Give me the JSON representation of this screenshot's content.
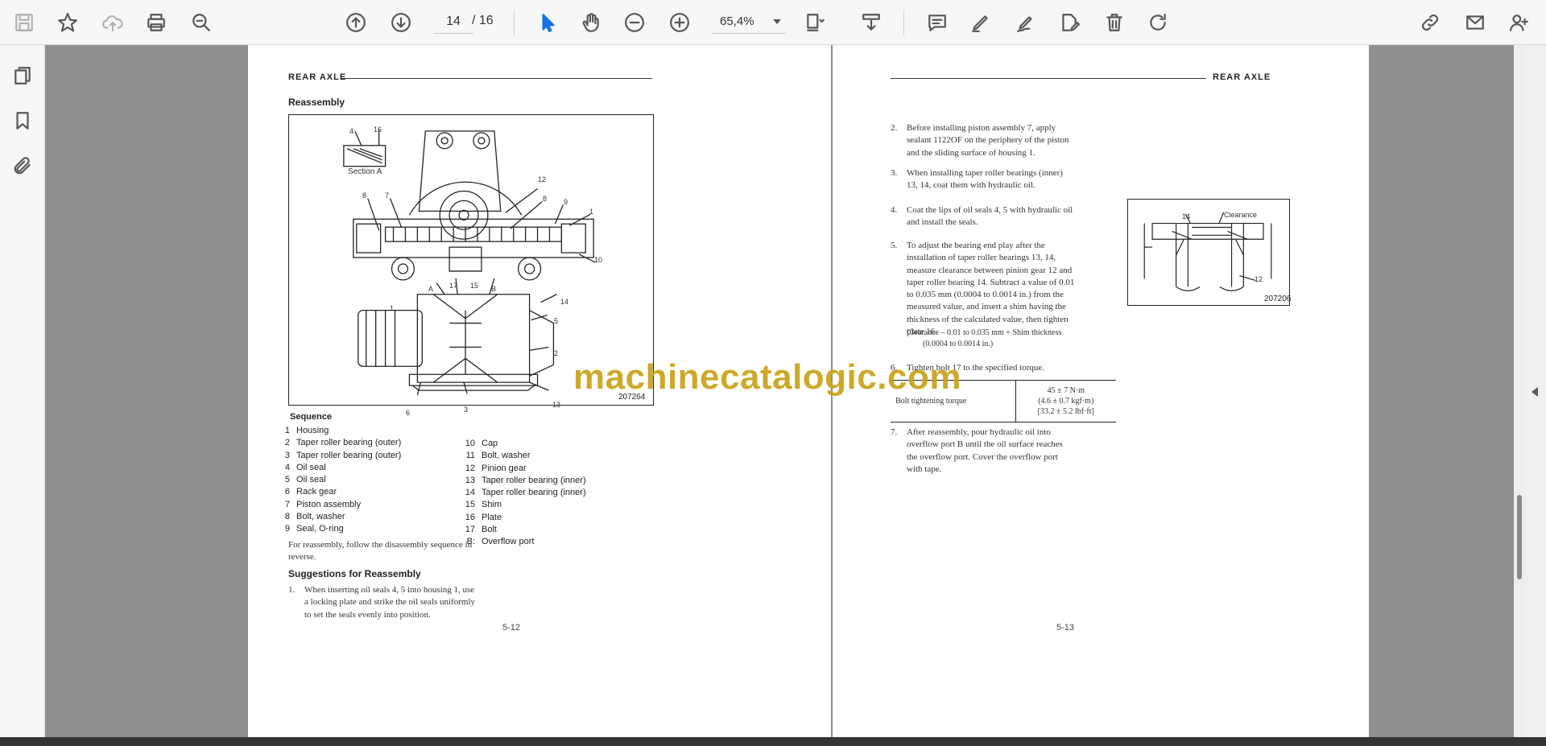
{
  "toolbar": {
    "page_current": "14",
    "page_total": "/ 16",
    "zoom": "65,4%"
  },
  "document": {
    "left_page": {
      "header": "REAR AXLE",
      "section_title": "Reassembly",
      "figure_code": "207264",
      "figure_labels": [
        "4",
        "16",
        "Section A",
        "8",
        "7",
        "12",
        "8",
        "9",
        "1",
        "10",
        "A",
        "17",
        "15",
        "B",
        "14",
        "5",
        "2",
        "13",
        "6",
        "3",
        "1"
      ],
      "sequence_title": "Sequence",
      "sequence_left": [
        {
          "n": "1",
          "t": "Housing"
        },
        {
          "n": "2",
          "t": "Taper roller bearing (outer)"
        },
        {
          "n": "3",
          "t": "Taper roller bearing (outer)"
        },
        {
          "n": "4",
          "t": "Oil seal"
        },
        {
          "n": "5",
          "t": "Oil seal"
        },
        {
          "n": "6",
          "t": "Rack gear"
        },
        {
          "n": "7",
          "t": "Piston assembly"
        },
        {
          "n": "8",
          "t": "Bolt, washer"
        },
        {
          "n": "9",
          "t": "Seal, O-ring"
        }
      ],
      "sequence_right": [
        {
          "n": "10",
          "t": "Cap"
        },
        {
          "n": "11",
          "t": "Bolt, washer"
        },
        {
          "n": "12",
          "t": "Pinion gear"
        },
        {
          "n": "13",
          "t": "Taper roller bearing (inner)"
        },
        {
          "n": "14",
          "t": "Taper roller bearing (inner)"
        },
        {
          "n": "15",
          "t": "Shim"
        },
        {
          "n": "16",
          "t": "Plate"
        },
        {
          "n": "17",
          "t": "Bolt"
        },
        {
          "n": "B:",
          "t": "Overflow port"
        }
      ],
      "reassembly_note": "For reassembly, follow the disassembly sequence in reverse.",
      "suggestions_title": "Suggestions for Reassembly",
      "suggestion_1_n": "1.",
      "suggestion_1": "When inserting oil seals 4, 5 into housing 1, use a locking plate and strike the oil seals uniformly to set the seals evenly into position.",
      "page_number": "5-12"
    },
    "right_page": {
      "header": "REAR AXLE",
      "steps": [
        {
          "n": "2.",
          "t": "Before installing piston assembly 7, apply sealant 1122OF on the periphery of the piston and the sliding surface of housing 1."
        },
        {
          "n": "3.",
          "t": "When installing taper roller bearings (inner) 13, 14, coat them with hydraulic oil."
        },
        {
          "n": "4.",
          "t": "Coat the lips of oil seals 4, 5 with hydraulic oil and install the seals."
        },
        {
          "n": "5.",
          "t": "To adjust the bearing end play after the installation of taper roller bearings 13, 14, measure clearance between pinion gear 12 and taper roller bearing 14. Subtract a value of 0.01 to 0.035 mm (0.0004 to 0.0014 in.) from the measured value, and insert a shim having the thickness of the calculated value, then tighten plate 16."
        }
      ],
      "clearance_formula": "Clearance – 0.01 to 0.035 mm = Shim thickness",
      "clearance_formula_in": "(0.0004 to 0.0014 in.)",
      "step_6_n": "6.",
      "step_6": "Tighten bolt 17 to the specified torque.",
      "torque_label": "Bolt tightening torque",
      "torque_values": [
        "45 ± 7 N·m",
        "(4.6 ± 0.7 kgf·m)",
        "[33.2 ± 5.2 lbf·ft]"
      ],
      "step_7_n": "7.",
      "step_7": "After reassembly, pour hydraulic oil into overflow port B until the oil surface reaches the overflow port. Cover the overflow port with tape.",
      "figure_code": "207206",
      "figure_labels": [
        "14",
        "Clearance",
        "12"
      ],
      "page_number": "5-13"
    }
  },
  "watermark": "machinecatalogic.com",
  "colors": {
    "toolbar_bg": "#f7f7f7",
    "viewer_bg": "#8f8f8f",
    "page_bg": "#ffffff",
    "active_tool": "#1473e6",
    "watermark": "#c9a21a"
  },
  "icons": {
    "toolbar": [
      "save-icon",
      "bookmark-star-icon",
      "upload-cloud-icon",
      "print-icon",
      "zoom-search-icon",
      "page-up-icon",
      "page-down-icon",
      "select-arrow-icon",
      "hand-icon",
      "zoom-out-icon",
      "zoom-in-icon",
      "page-fit-icon",
      "scroll-mode-icon",
      "comment-icon",
      "highlight-pen-icon",
      "sign-icon",
      "edit-pdf-icon",
      "delete-icon",
      "rotate-icon",
      "share-link-icon",
      "mail-icon",
      "add-user-icon"
    ],
    "sidebar": [
      "pages-icon",
      "bookmark-icon",
      "attachment-icon"
    ]
  }
}
